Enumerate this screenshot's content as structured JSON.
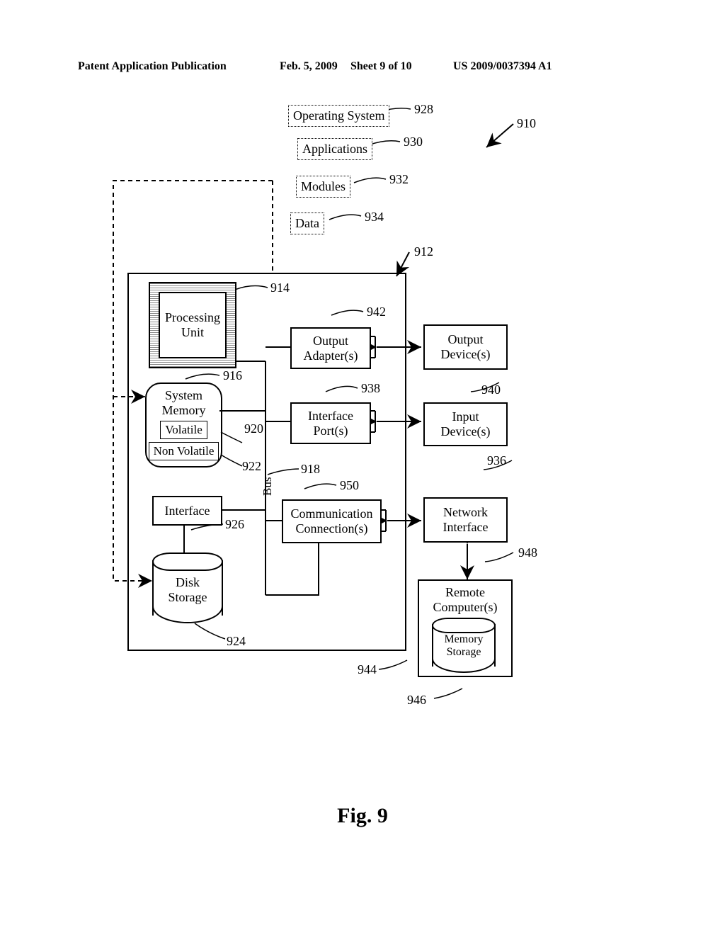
{
  "header": {
    "left": "Patent Application Publication",
    "date": "Feb. 5, 2009",
    "sheet": "Sheet 9 of 10",
    "pubno": "US 2009/0037394 A1"
  },
  "figure_caption": "Fig. 9",
  "blocks": {
    "os": "Operating System",
    "applications": "Applications",
    "modules": "Modules",
    "data": "Data",
    "processing_unit": "Processing\nUnit",
    "system_memory": "System\nMemory",
    "volatile": "Volatile",
    "nonvolatile": "Non Volatile",
    "interface": "Interface",
    "disk_storage": "Disk\nStorage",
    "output_adapters": "Output\nAdapter(s)",
    "interface_ports": "Interface\nPort(s)",
    "comm_conn": "Communication\nConnection(s)",
    "output_devices": "Output\nDevice(s)",
    "input_devices": "Input\nDevice(s)",
    "network_interface": "Network\nInterface",
    "remote_computers": "Remote\nComputer(s)",
    "memory_storage": "Memory\nStorage",
    "bus": "Bus"
  },
  "refs": {
    "r910": "910",
    "r912": "912",
    "r914": "914",
    "r916": "916",
    "r918": "918",
    "r920": "920",
    "r922": "922",
    "r924": "924",
    "r926": "926",
    "r928": "928",
    "r930": "930",
    "r932": "932",
    "r934": "934",
    "r936": "936",
    "r938": "938",
    "r940": "940",
    "r942": "942",
    "r944": "944",
    "r946": "946",
    "r948": "948",
    "r950": "950"
  }
}
